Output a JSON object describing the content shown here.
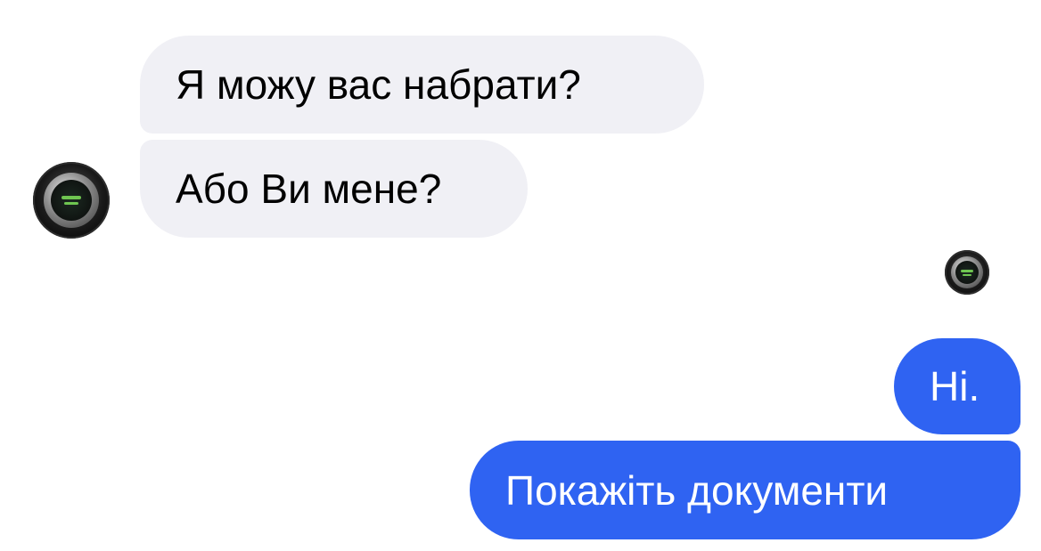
{
  "conversation": {
    "messages": [
      {
        "sender": "contact",
        "text": "Я можу вас набрати?"
      },
      {
        "sender": "contact",
        "text": "Або Ви мене?"
      },
      {
        "sender": "me",
        "text": "Ні."
      },
      {
        "sender": "me",
        "text": "Покажіть документи"
      }
    ],
    "avatars": {
      "contact": "avatar-icon",
      "read_receipt": "read-receipt-avatar-icon"
    },
    "colors": {
      "incoming_bubble": "#f0f0f5",
      "outgoing_bubble": "#2f63f2",
      "incoming_text": "#000000",
      "outgoing_text": "#ffffff"
    }
  }
}
